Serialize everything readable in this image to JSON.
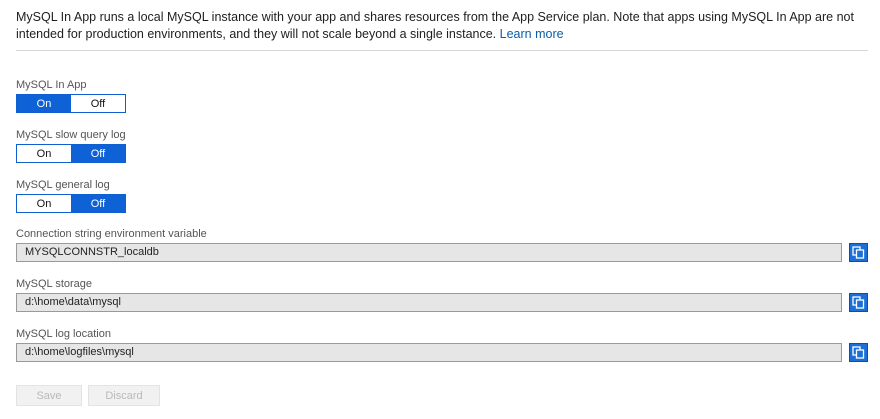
{
  "intro": {
    "text": "MySQL In App runs a local MySQL instance with your app and shares resources from the App Service plan. Note that apps using MySQL In App are not intended for production environments, and they will not scale beyond a single instance.",
    "link": "Learn more"
  },
  "settings": {
    "mysql_in_app": {
      "label": "MySQL In App",
      "on": "On",
      "off": "Off",
      "selected": "On"
    },
    "slow_query_log": {
      "label": "MySQL slow query log",
      "on": "On",
      "off": "Off",
      "selected": "Off"
    },
    "general_log": {
      "label": "MySQL general log",
      "on": "On",
      "off": "Off",
      "selected": "Off"
    }
  },
  "fields": {
    "connection_string": {
      "label": "Connection string environment variable",
      "value": "MYSQLCONNSTR_localdb"
    },
    "storage": {
      "label": "MySQL storage",
      "value": "d:\\home\\data\\mysql"
    },
    "log_location": {
      "label": "MySQL log location",
      "value": "d:\\home\\logfiles\\mysql"
    }
  },
  "actions": {
    "save": "Save",
    "discard": "Discard"
  },
  "colors": {
    "accent": "#0f62d6",
    "link": "#0a5ea8"
  },
  "icons": {
    "copy": "copy-icon"
  }
}
